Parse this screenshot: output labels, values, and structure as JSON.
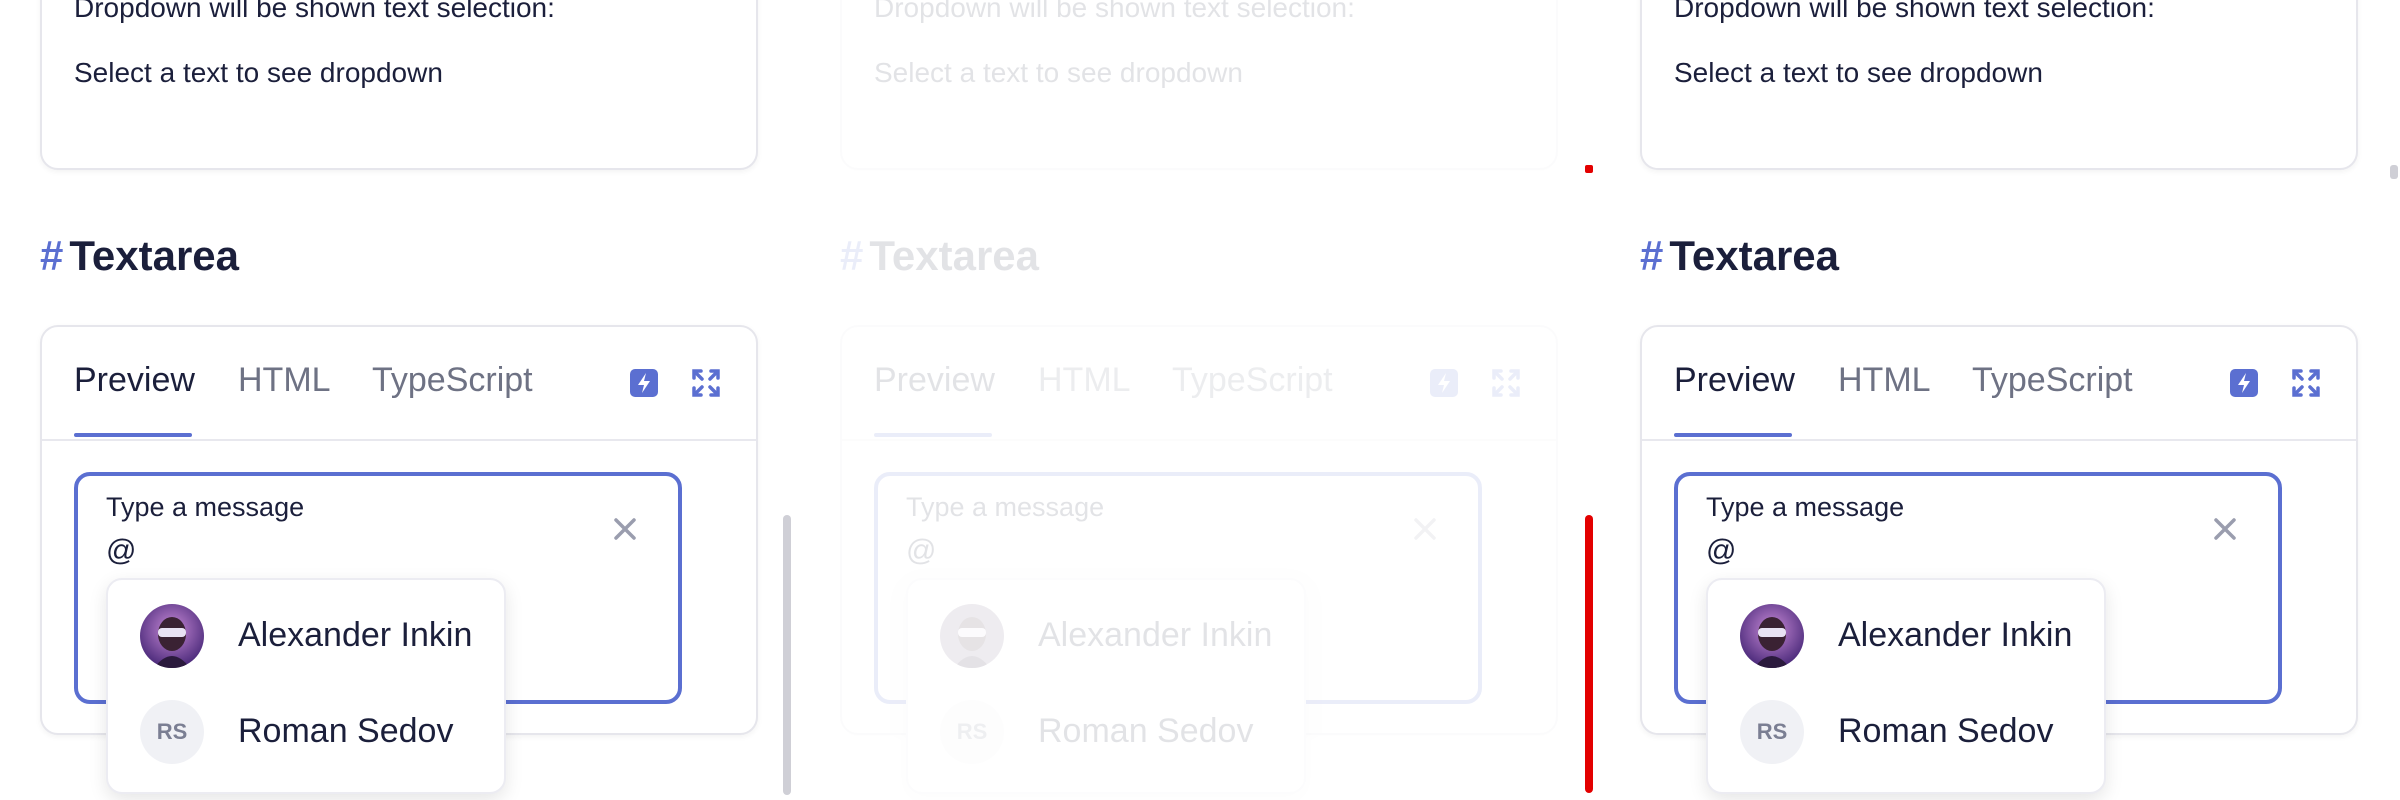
{
  "top_card": {
    "line1": "Dropdown will be shown text selection:",
    "line2": "Select a text to see dropdown"
  },
  "section": {
    "hash": "#",
    "title": "Textarea"
  },
  "tabs": [
    {
      "label": "Preview",
      "active": true
    },
    {
      "label": "HTML",
      "active": false
    },
    {
      "label": "TypeScript",
      "active": false
    }
  ],
  "toolbar_icons": [
    "lightning-icon",
    "expand-icon"
  ],
  "textarea": {
    "label": "Type a message",
    "value": "@"
  },
  "dropdown": {
    "options": [
      {
        "name": "Alexander Inkin",
        "avatar": "photo"
      },
      {
        "name": "Roman Sedov",
        "avatar": "RS"
      }
    ]
  },
  "colors": {
    "accent": "#5b6fd1",
    "text": "#1b1f3b",
    "muted": "#6e7284",
    "border": "#e6e6ec",
    "red": "#e30000"
  }
}
